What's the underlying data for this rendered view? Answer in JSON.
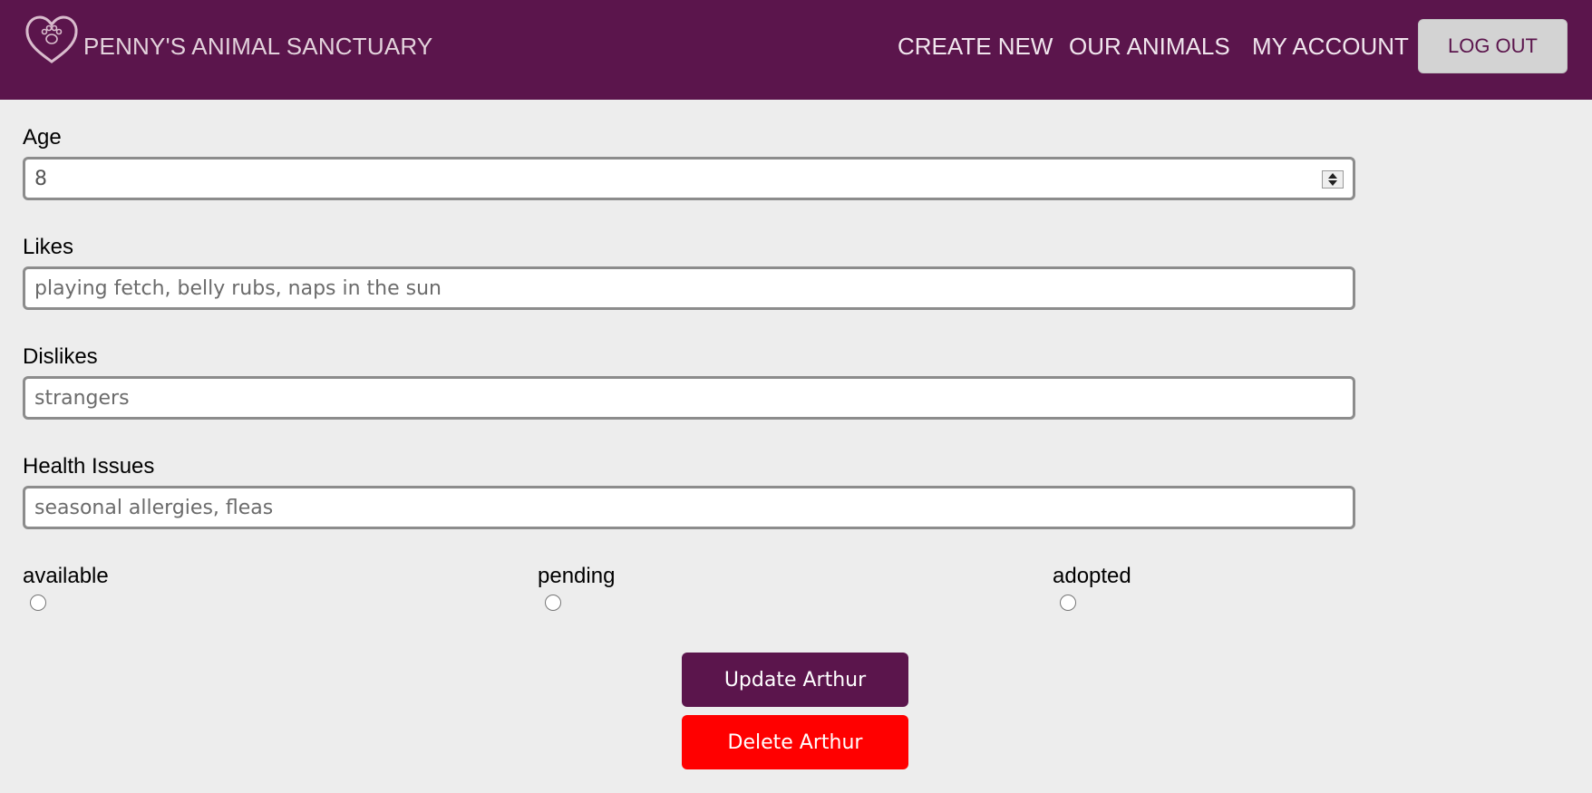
{
  "header": {
    "brand": "PENNY'S ANIMAL SANCTUARY",
    "logo_icon": "heart-paw-icon",
    "nav": [
      "CREATE NEW",
      "OUR ANIMALS",
      "MY ACCOUNT"
    ],
    "logout_label": "LOG OUT"
  },
  "form": {
    "age": {
      "label": "Age",
      "value": "8"
    },
    "likes": {
      "label": "Likes",
      "placeholder": "playing fetch, belly rubs, naps in the sun"
    },
    "dislikes": {
      "label": "Dislikes",
      "placeholder": "strangers"
    },
    "health": {
      "label": "Health Issues",
      "placeholder": "seasonal allergies, fleas"
    },
    "status": [
      "available",
      "pending",
      "adopted"
    ]
  },
  "actions": {
    "update_label": "Update Arthur",
    "delete_label": "Delete Arthur"
  },
  "colors": {
    "brand": "#5b154c",
    "delete": "#ff0000",
    "background": "#ededed"
  }
}
